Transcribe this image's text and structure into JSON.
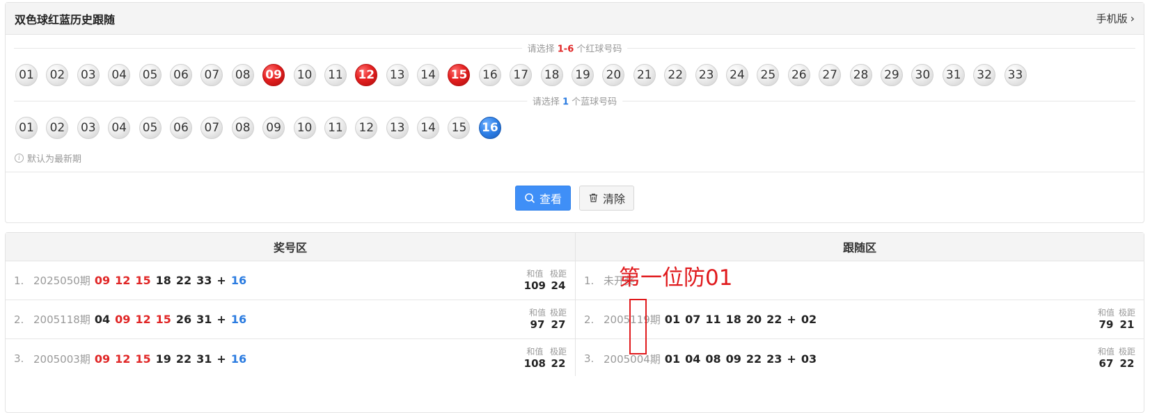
{
  "header": {
    "title": "双色球红蓝历史跟随",
    "mobile_label": "手机版"
  },
  "red_picker": {
    "prompt_prefix": "请选择 ",
    "prompt_range": "1-6",
    "prompt_suffix": " 个红球号码",
    "balls": [
      "01",
      "02",
      "03",
      "04",
      "05",
      "06",
      "07",
      "08",
      "09",
      "10",
      "11",
      "12",
      "13",
      "14",
      "15",
      "16",
      "17",
      "18",
      "19",
      "20",
      "21",
      "22",
      "23",
      "24",
      "25",
      "26",
      "27",
      "28",
      "29",
      "30",
      "31",
      "32",
      "33"
    ],
    "selected": [
      "09",
      "12",
      "15"
    ]
  },
  "blue_picker": {
    "prompt_prefix": "请选择 ",
    "prompt_range": "1",
    "prompt_suffix": " 个蓝球号码",
    "balls": [
      "01",
      "02",
      "03",
      "04",
      "05",
      "06",
      "07",
      "08",
      "09",
      "10",
      "11",
      "12",
      "13",
      "14",
      "15",
      "16"
    ],
    "selected": [
      "16"
    ]
  },
  "hint": "默认为最新期",
  "buttons": {
    "view": "查看",
    "clear": "清除"
  },
  "results": {
    "left_title": "奖号区",
    "right_title": "跟随区",
    "sum_label": "和值",
    "span_label": "极距",
    "left_rows": [
      {
        "idx": "1.",
        "issue": "2025050期",
        "reds": [
          "09",
          "12",
          "15",
          "18",
          "22",
          "33"
        ],
        "hl": [
          "09",
          "12",
          "15"
        ],
        "blue": "16",
        "sum": "109",
        "span": "24"
      },
      {
        "idx": "2.",
        "issue": "2005118期",
        "reds": [
          "04",
          "09",
          "12",
          "15",
          "26",
          "31"
        ],
        "hl": [
          "09",
          "12",
          "15"
        ],
        "blue": "16",
        "sum": "97",
        "span": "27"
      },
      {
        "idx": "3.",
        "issue": "2005003期",
        "reds": [
          "09",
          "12",
          "15",
          "19",
          "22",
          "31"
        ],
        "hl": [
          "09",
          "12",
          "15"
        ],
        "blue": "16",
        "sum": "108",
        "span": "22"
      }
    ],
    "right_rows": [
      {
        "idx": "1.",
        "status": "未开奖"
      },
      {
        "idx": "2.",
        "issue": "2005119期",
        "reds": [
          "01",
          "07",
          "11",
          "18",
          "20",
          "22"
        ],
        "blue": "02",
        "sum": "79",
        "span": "21"
      },
      {
        "idx": "3.",
        "issue": "2005004期",
        "reds": [
          "01",
          "04",
          "08",
          "09",
          "22",
          "23"
        ],
        "blue": "03",
        "sum": "67",
        "span": "22"
      }
    ]
  },
  "annotation": "第一位防01",
  "colors": {
    "red": "#e02525",
    "blue": "#2a7be0",
    "primary": "#3f8ff7",
    "annotation": "#e0191c"
  }
}
